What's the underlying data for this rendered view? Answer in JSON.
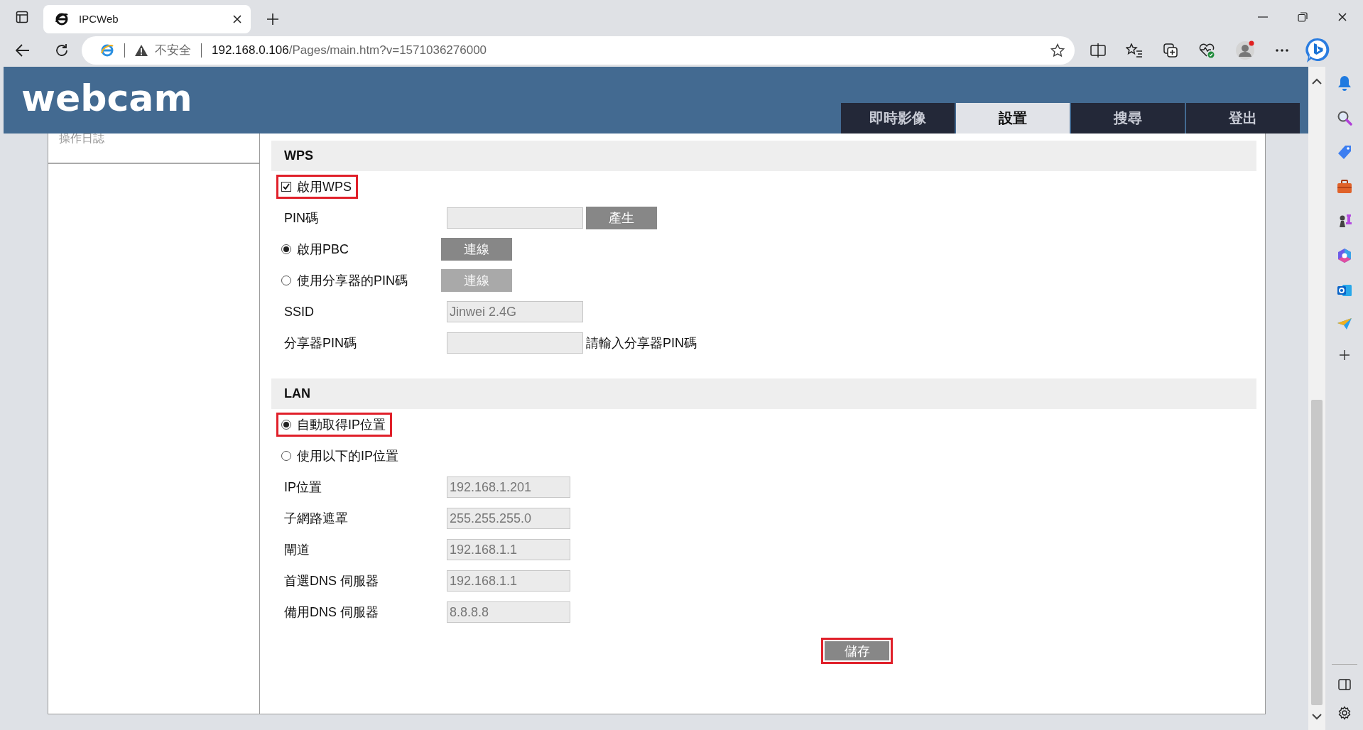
{
  "browser": {
    "tab_title": "IPCWeb",
    "security_label": "不安全",
    "url_host": "192.168.0.106",
    "url_path": "/Pages/main.htm?v=1571036276000"
  },
  "header": {
    "logo": "webcam",
    "nav_tabs": [
      {
        "label": "即時影像",
        "selected": false
      },
      {
        "label": "設置",
        "selected": true
      },
      {
        "label": "搜尋",
        "selected": false
      },
      {
        "label": "登出",
        "selected": false
      }
    ]
  },
  "sidebar": {
    "items": [
      "操作日誌"
    ]
  },
  "sections": [
    {
      "title": "WPS",
      "rows": [
        {
          "kind": "checkbox",
          "label": "啟用WPS",
          "checked": true,
          "highlighted": true
        },
        {
          "kind": "field",
          "label": "PIN碼",
          "field": {
            "disabled": true
          },
          "button": {
            "label": "產生",
            "disabled": false
          }
        },
        {
          "kind": "radio",
          "label": "啟用PBC",
          "selected": true,
          "highlighted": false,
          "button": {
            "label": "連線",
            "disabled": false
          }
        },
        {
          "kind": "radio",
          "label": "使用分享器的PIN碼",
          "selected": false,
          "highlighted": false,
          "button": {
            "label": "連線",
            "disabled": true
          }
        },
        {
          "kind": "field",
          "label": "SSID",
          "field": {
            "value": "Jinwei 2.4G",
            "disabled": true
          }
        },
        {
          "kind": "field",
          "label": "分享器PIN碼",
          "field": {
            "disabled": true
          },
          "note": "請輸入分享器PIN碼"
        }
      ]
    },
    {
      "title": "LAN",
      "rows": [
        {
          "kind": "radio",
          "label": "自動取得IP位置",
          "selected": true,
          "highlighted": true
        },
        {
          "kind": "radio",
          "label": "使用以下的IP位置",
          "selected": false,
          "highlighted": false
        },
        {
          "kind": "field",
          "label": "IP位置",
          "field": {
            "value": "192.168.1.201",
            "disabled": true
          }
        },
        {
          "kind": "field",
          "label": "子網路遮罩",
          "field": {
            "value": "255.255.255.0",
            "disabled": true
          }
        },
        {
          "kind": "field",
          "label": "閘道",
          "field": {
            "value": "192.168.1.1",
            "disabled": true
          }
        },
        {
          "kind": "field",
          "label": "首選DNS 伺服器",
          "field": {
            "value": "192.168.1.1",
            "disabled": true
          }
        },
        {
          "kind": "field",
          "label": "備用DNS 伺服器",
          "field": {
            "value": "8.8.8.8",
            "disabled": true
          }
        }
      ]
    }
  ],
  "save_button": {
    "label": "儲存",
    "highlighted": true
  }
}
